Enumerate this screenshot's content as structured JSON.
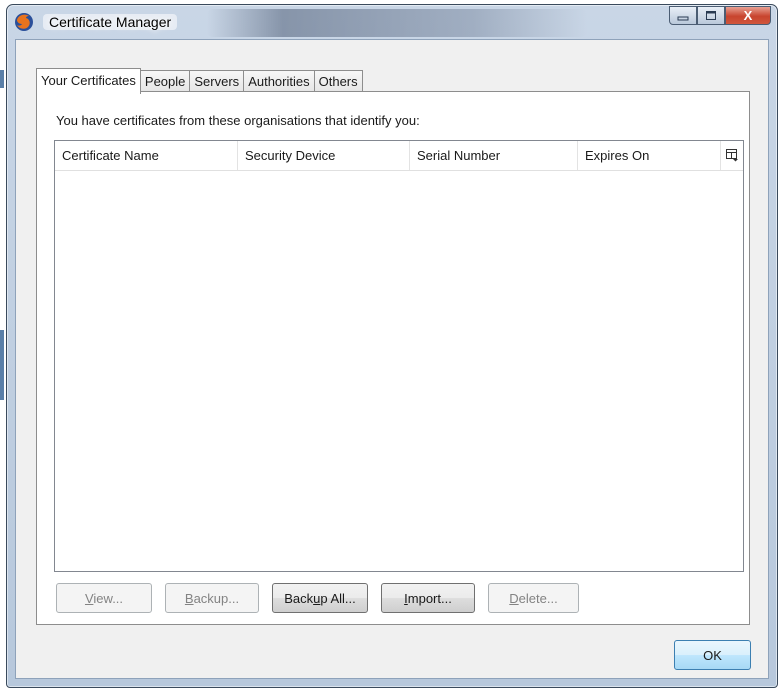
{
  "window": {
    "title": "Certificate Manager",
    "controls": {
      "minimize_icon": "minimize-icon",
      "maximize_icon": "maximize-icon",
      "close_label": "X"
    }
  },
  "tabs": [
    {
      "label": "Your Certificates",
      "active": true
    },
    {
      "label": "People",
      "active": false
    },
    {
      "label": "Servers",
      "active": false
    },
    {
      "label": "Authorities",
      "active": false
    },
    {
      "label": "Others",
      "active": false
    }
  ],
  "panel": {
    "intro": "You have certificates from these organisations that identify you:"
  },
  "table": {
    "columns": [
      "Certificate Name",
      "Security Device",
      "Serial Number",
      "Expires On"
    ],
    "column_picker_icon": "column-picker-icon",
    "rows": []
  },
  "actions": [
    {
      "label": "View...",
      "accesskey_index": 0,
      "enabled": false
    },
    {
      "label": "Backup...",
      "accesskey_index": 0,
      "enabled": false
    },
    {
      "label": "Backup All...",
      "accesskey_index": 4,
      "enabled": true
    },
    {
      "label": "Import...",
      "accesskey_index": 0,
      "enabled": true
    },
    {
      "label": "Delete...",
      "accesskey_index": 0,
      "enabled": false
    }
  ],
  "ok_label": "OK",
  "colors": {
    "close_button": "#c8442e",
    "ok_button_border": "#3c7fb1"
  }
}
